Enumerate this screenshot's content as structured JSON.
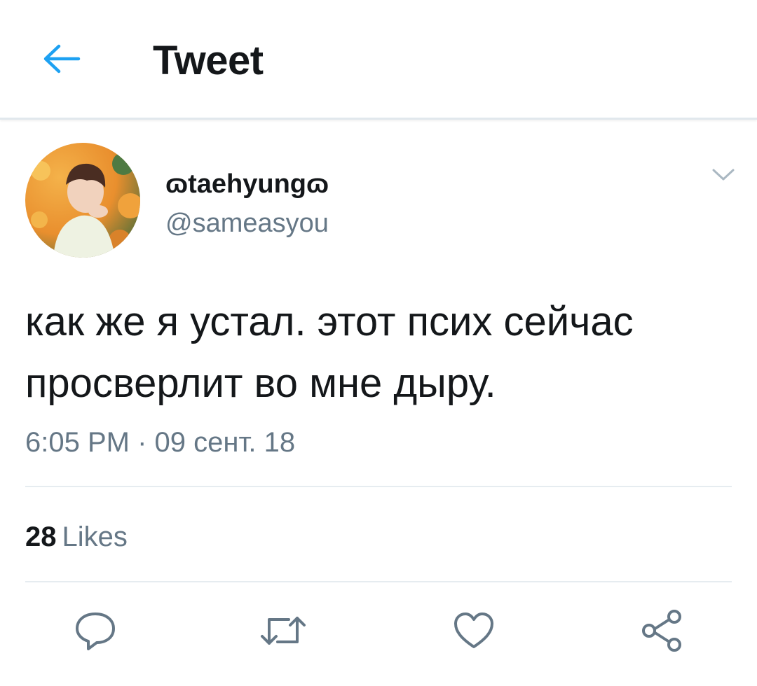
{
  "header": {
    "title": "Tweet",
    "back_icon": "back-arrow-icon",
    "accent_color": "#1da1f2"
  },
  "author": {
    "display_name": "ɷtaehyungɷ",
    "username": "@sameasyou"
  },
  "tweet": {
    "text": "как же я устал. этот псих сейчас просверлит во мне дыру.",
    "timestamp": "6:05 PM · 09 сент. 18"
  },
  "stats": {
    "likes_count": "28",
    "likes_label": "Likes"
  },
  "actions": [
    {
      "name": "reply",
      "icon": "reply-icon"
    },
    {
      "name": "retweet",
      "icon": "retweet-icon"
    },
    {
      "name": "like",
      "icon": "heart-icon"
    },
    {
      "name": "share",
      "icon": "share-icon"
    }
  ],
  "colors": {
    "text_primary": "#14171a",
    "text_secondary": "#657786",
    "divider": "#e6ecf0",
    "icon_gray": "#657786"
  }
}
